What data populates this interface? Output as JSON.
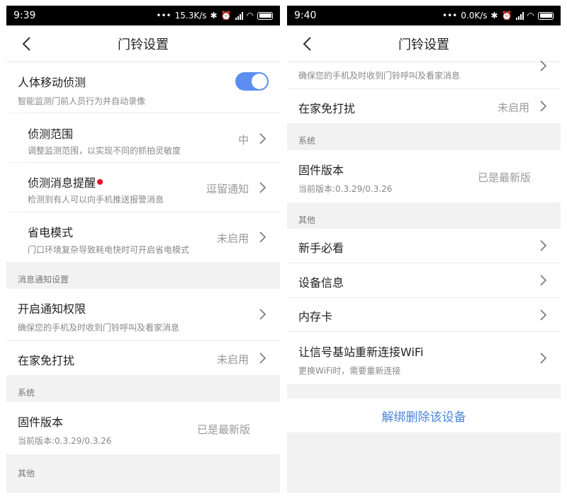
{
  "left": {
    "status": {
      "time": "9:39",
      "speed": "15.3K/s"
    },
    "nav_title": "门铃设置",
    "motion": {
      "label": "人体移动侦测",
      "sub": "智能监测门前人员行为并自动录像"
    },
    "range": {
      "label": "侦测范围",
      "sub": "调整监测范围，以实现不同的抓拍灵敏度",
      "value": "中"
    },
    "alert": {
      "label": "侦测消息提醒",
      "sub": "检测到有人可以向手机推送报警消息",
      "value": "逗留通知"
    },
    "power": {
      "label": "省电模式",
      "sub": "门口环境复杂导致耗电快时可开启省电模式",
      "value": "未启用"
    },
    "notify_section": "消息通知设置",
    "notify": {
      "label": "开启通知权限",
      "sub": "确保您的手机及时收到门铃呼叫及看家消息"
    },
    "dnd": {
      "label": "在家免打扰",
      "value": "未启用"
    },
    "system_section": "系统",
    "firmware": {
      "label": "固件版本",
      "sub": "当前版本:0.3.29/0.3.26",
      "value": "已是最新版"
    },
    "other_section": "其他"
  },
  "right": {
    "status": {
      "time": "9:40",
      "speed": "0.0K/s"
    },
    "nav_title": "门铃设置",
    "notify_sub": "确保您的手机及时收到门铃呼叫及看家消息",
    "dnd": {
      "label": "在家免打扰",
      "value": "未启用"
    },
    "system_section": "系统",
    "firmware": {
      "label": "固件版本",
      "sub": "当前版本:0.3.29/0.3.26",
      "value": "已是最新版"
    },
    "other_section": "其他",
    "guide": {
      "label": "新手必看"
    },
    "device_info": {
      "label": "设备信息"
    },
    "storage": {
      "label": "内存卡"
    },
    "wifi": {
      "label": "让信号基站重新连接WiFi",
      "sub": "更换WiFi时，需要重新连接"
    },
    "unbind": "解绑删除该设备"
  },
  "colors": {
    "accent": "#5b8ef0",
    "link": "#4a86d8",
    "badge": "#e81123"
  }
}
